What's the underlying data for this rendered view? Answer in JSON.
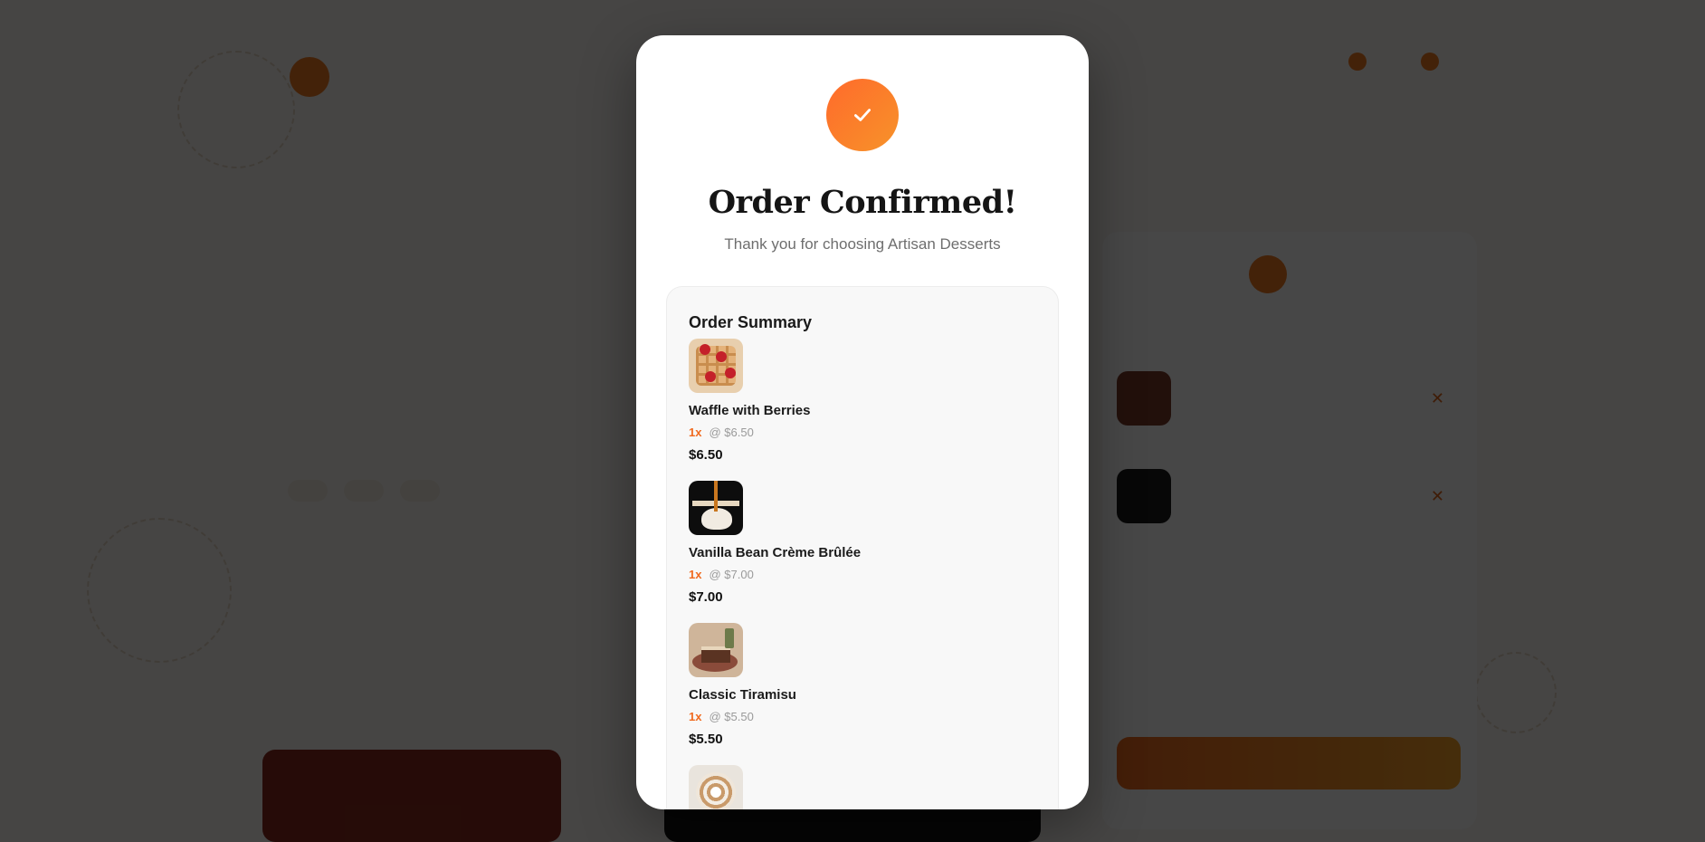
{
  "background_page": {
    "header": {
      "nav_items": [
        {
          "icon": "user-icon"
        },
        {
          "icon": "cart-icon"
        }
      ]
    },
    "hero": {},
    "cart": {}
  },
  "modal": {
    "icon": "check-icon",
    "title": "Order Confirmed!",
    "subtitle": "Thank you for choosing Artisan Desserts",
    "summary": {
      "title": "Order Summary",
      "items": [
        {
          "name": "Waffle with Berries",
          "qty": "1x",
          "unit_price": "@ $6.50",
          "total": "$6.50",
          "image": "waffle-with-berries"
        },
        {
          "name": "Vanilla Bean Crème Brûlée",
          "qty": "1x",
          "unit_price": "@ $7.00",
          "total": "$7.00",
          "image": "creme-brulee"
        },
        {
          "name": "Classic Tiramisu",
          "qty": "1x",
          "unit_price": "@ $5.50",
          "total": "$5.50",
          "image": "tiramisu"
        },
        {
          "name": "",
          "qty": "",
          "unit_price": "",
          "total": "",
          "image": "partially-visible-dessert"
        }
      ]
    }
  },
  "colors": {
    "accent": "#f06a1f",
    "accent_gradient_end": "#f7932a",
    "overlay": "rgba(0,0,0,0.72)",
    "modal_bg": "#ffffff",
    "summary_bg": "#f8f8f8"
  }
}
